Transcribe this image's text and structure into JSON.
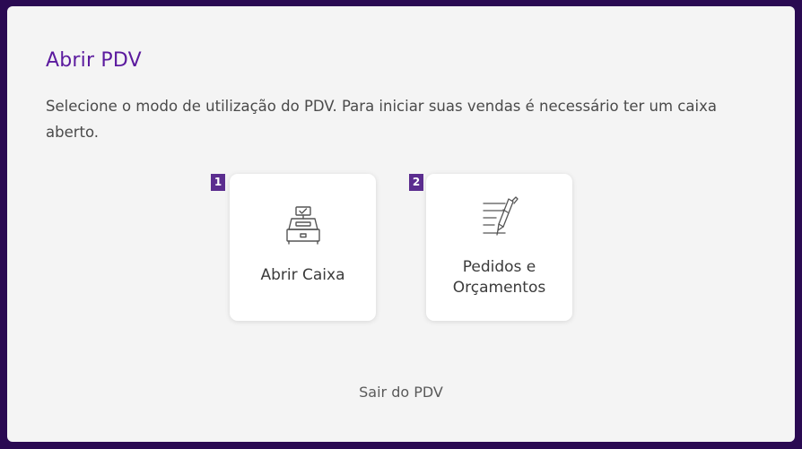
{
  "dialog": {
    "title": "Abrir PDV",
    "description": "Selecione o modo de utilização do PDV. Para iniciar suas vendas é necessário ter um caixa aberto."
  },
  "options": [
    {
      "badge": "1",
      "label": "Abrir Caixa",
      "icon": "cash-register-icon"
    },
    {
      "badge": "2",
      "label_line1": "Pedidos e",
      "label_line2": "Orçamentos",
      "icon": "pen-notes-icon"
    }
  ],
  "exit": {
    "label": "Sair do PDV"
  },
  "colors": {
    "background": "#2a0a52",
    "panel": "#f4f4f4",
    "title": "#5b1a9e",
    "badge": "#5b2d8f"
  }
}
